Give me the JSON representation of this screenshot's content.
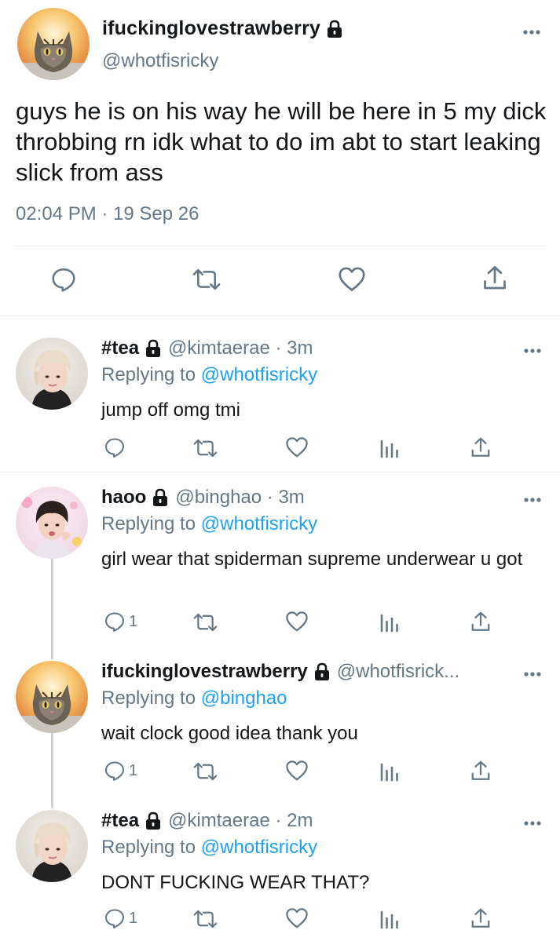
{
  "main_tweet": {
    "display_name": "ifuckinglovestrawberry",
    "handle": "@whotfisricky",
    "text": "guys he is on his way he will be here in 5 my dick throbbing rn idk what to do im abt to start leaking slick from ass",
    "meta": "02:04 PM · 19 Sep 26",
    "avatar_icon": "cat-avatar",
    "locked_icon": "lock-icon"
  },
  "replies": [
    {
      "display_name": "#tea",
      "handle": "@kimtaerae · 3m",
      "replying_prefix": "Replying to",
      "replying_to": "@whotfisricky",
      "text": "jump off omg tmi",
      "reply_count": "",
      "avatar_icon": "blond-person-avatar"
    },
    {
      "display_name": "haoo",
      "handle": "@binghao · 3m",
      "replying_prefix": "Replying to",
      "replying_to": "@whotfisricky",
      "text": "girl wear that spiderman supreme underwear u got",
      "reply_count": "1",
      "avatar_icon": "person-avatar"
    },
    {
      "display_name": "ifuckinglovestrawberry",
      "handle": "@whotfisrick...",
      "replying_prefix": "Replying to",
      "replying_to": "@binghao",
      "text": "wait clock good idea thank you",
      "reply_count": "1",
      "avatar_icon": "cat-avatar"
    },
    {
      "display_name": "#tea",
      "handle": "@kimtaerae · 2m",
      "replying_prefix": "Replying to",
      "replying_to": "@whotfisricky",
      "text": "DONT FUCKING WEAR THAT?",
      "reply_count": "1",
      "avatar_icon": "blond-person-avatar"
    }
  ],
  "colors": {
    "text": "#14171a",
    "secondary": "#657786",
    "link": "#1da1f2",
    "divider": "#e6ecf0",
    "thread_line": "#ccd6dd"
  }
}
